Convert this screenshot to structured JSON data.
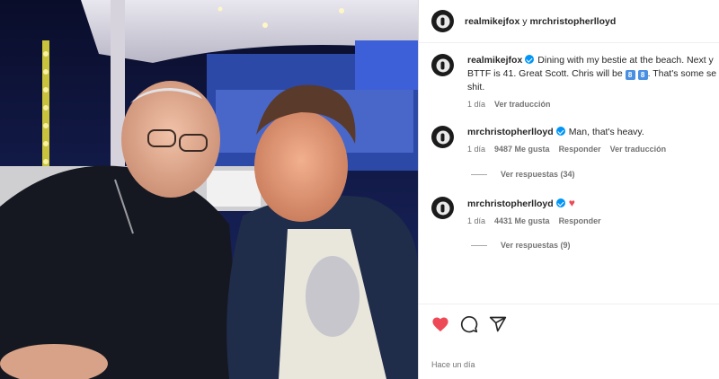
{
  "header": {
    "user1": "realmikejfox",
    "joiner": "y",
    "user2": "mrchristopherlloyd"
  },
  "caption": {
    "username": "realmikejfox",
    "text_before": "Dining with my bestie at the beach. Next y",
    "text_line2_start": "BTTF is 41. Great Scott. Chris will be ",
    "emoji1": "8",
    "emoji2": "8",
    "text_line2_end": ". That's some se",
    "text_line3": "shit.",
    "time": "1 día",
    "translate": "Ver traducción"
  },
  "comments": [
    {
      "username": "mrchristopherlloyd",
      "text": "Man, that's heavy.",
      "time": "1 día",
      "likes": "9487 Me gusta",
      "reply": "Responder",
      "translate": "Ver traducción",
      "replies": "Ver respuestas (34)"
    },
    {
      "username": "mrchristopherlloyd",
      "text": "",
      "emoji": "♥",
      "time": "1 día",
      "likes": "4431 Me gusta",
      "reply": "Responder",
      "replies": "Ver respuestas (9)"
    }
  ],
  "actions": {
    "liked": true,
    "like_color": "#ed4956",
    "like_icon": "heart-filled",
    "comment_icon": "comment-bubble",
    "share_icon": "paper-plane"
  },
  "timeago": "Hace un día",
  "colors": {
    "verified": "#0095f6",
    "muted": "#737373"
  }
}
